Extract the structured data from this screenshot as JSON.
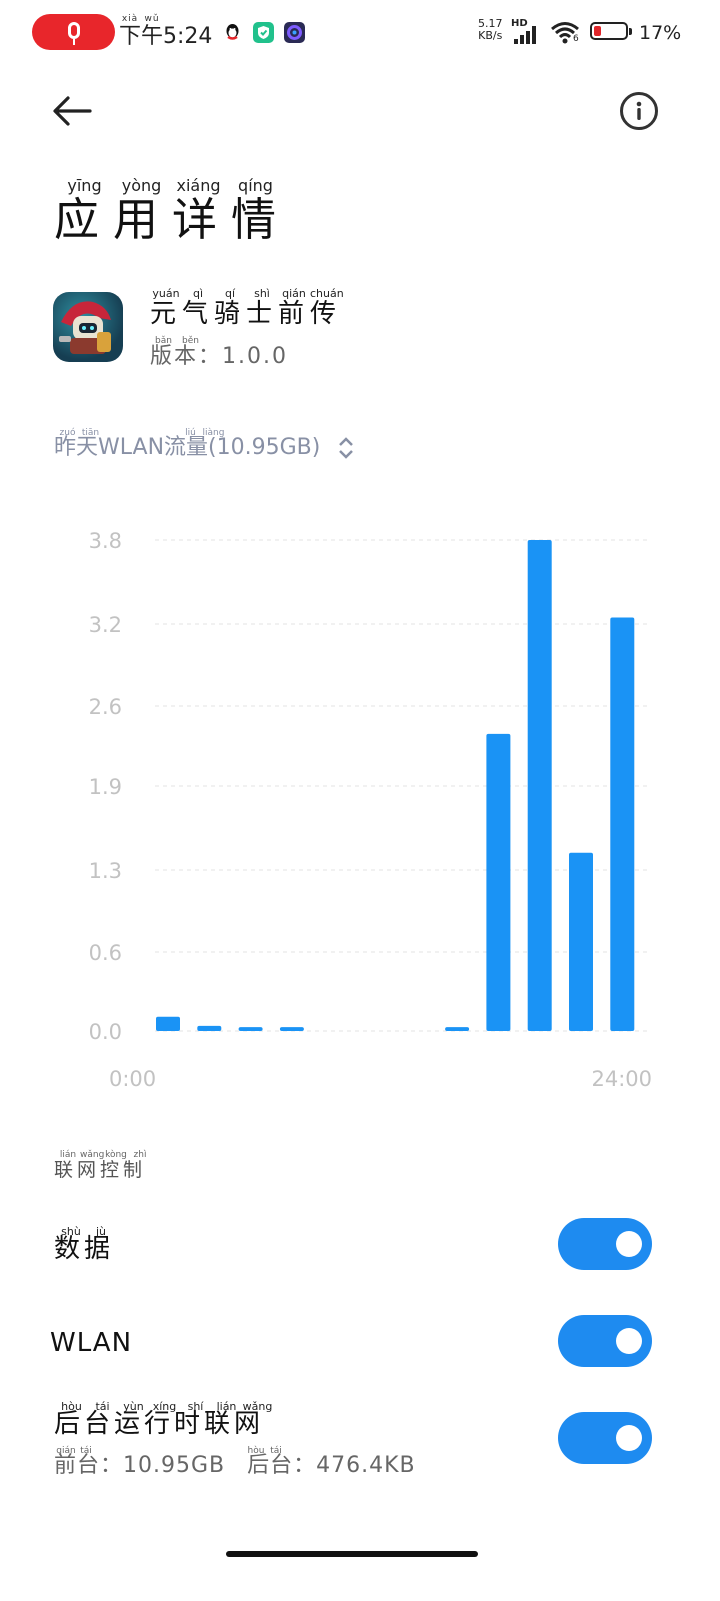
{
  "status_bar": {
    "time_pinyin": [
      "xià",
      "wǔ"
    ],
    "time": "下午5:24",
    "net_speed_value": "5.17",
    "net_speed_unit": "KB/s",
    "hd_label": "HD",
    "wifi_index": "6",
    "battery_percent": "17%",
    "colors": {
      "mic_pill": "#e8262b",
      "battery_low": "#e0262b"
    }
  },
  "header": {
    "title": "应用详情",
    "title_pinyin": [
      "yīng",
      "yòng",
      "xiáng",
      "qíng"
    ]
  },
  "app": {
    "name": "元气骑士前传",
    "name_pinyin": [
      "yuán",
      "qì",
      "qí",
      "shì",
      "qián",
      "chuán"
    ],
    "version_text": "版本：1.0.0",
    "version_pinyin": [
      "bǎn",
      "běn"
    ]
  },
  "usage_selector": {
    "label": "昨天WLAN流量(10.95GB)",
    "pinyin": [
      "zuó",
      "tiān",
      "",
      "",
      "",
      "",
      "liú",
      "liàng"
    ]
  },
  "chart_data": {
    "type": "bar",
    "y_ticks": [
      "3.8",
      "3.2",
      "2.6",
      "1.9",
      "1.3",
      "0.6",
      "0.0"
    ],
    "y_tick_values": [
      3.8,
      3.2,
      2.6,
      1.9,
      1.3,
      0.6,
      0.0
    ],
    "ylim": [
      0,
      3.8
    ],
    "x_start_label": "0:00",
    "x_end_label": "24:00",
    "slot_count": 12,
    "values": [
      0.11,
      0.04,
      0.03,
      0.03,
      0,
      0,
      0,
      0.03,
      2.3,
      3.8,
      1.38,
      3.2
    ],
    "grid": true,
    "bar_color": "#1a93f5"
  },
  "net_control": {
    "section_title": "联网控制",
    "section_pinyin": [
      "lián",
      "wǎng",
      "kòng",
      "zhì"
    ],
    "rows": [
      {
        "label": "数据",
        "pinyin": [
          "shù",
          "jù"
        ],
        "enabled": true
      },
      {
        "label": "WLAN",
        "pinyin": [],
        "enabled": true
      },
      {
        "label": "后台运行时联网",
        "pinyin": [
          "hòu",
          "tái",
          "yùn",
          "xíng",
          "shí",
          "lián",
          "wǎng"
        ],
        "enabled": true,
        "sub_foreground": "前台：10.95GB",
        "sub_background": "后台：476.4KB",
        "sub_fg_pinyin": [
          "qián",
          "tái"
        ],
        "sub_bg_pinyin": [
          "hòu",
          "tái"
        ]
      }
    ],
    "toggle_color": "#1e8bf0"
  }
}
